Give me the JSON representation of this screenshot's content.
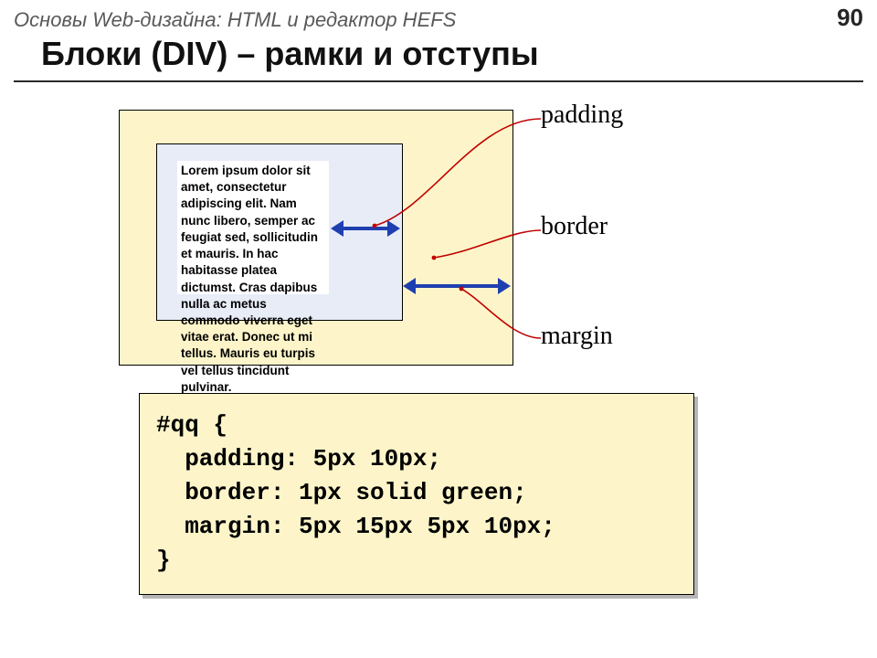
{
  "header": {
    "subtitle": "Основы Web-дизайна: HTML и редактор HEFS",
    "page": "90"
  },
  "title": "Блоки (DIV) – рамки и отступы",
  "labels": {
    "padding": "padding",
    "border": "border",
    "margin": "margin"
  },
  "lorem": "Lorem ipsum dolor sit amet, consectetur adipiscing elit. Nam nunc libero, semper ac feugiat sed, sollicitudin et mauris. In hac habitasse platea dictumst. Cras dapibus nulla ac metus commodo viverra eget vitae erat. Donec ut mi tellus. Mauris eu turpis vel tellus tincidunt pulvinar.",
  "code": "#qq {\n  padding: 5px 10px;\n  border: 1px solid green;\n  margin: 5px 15px 5px 10px;\n}"
}
